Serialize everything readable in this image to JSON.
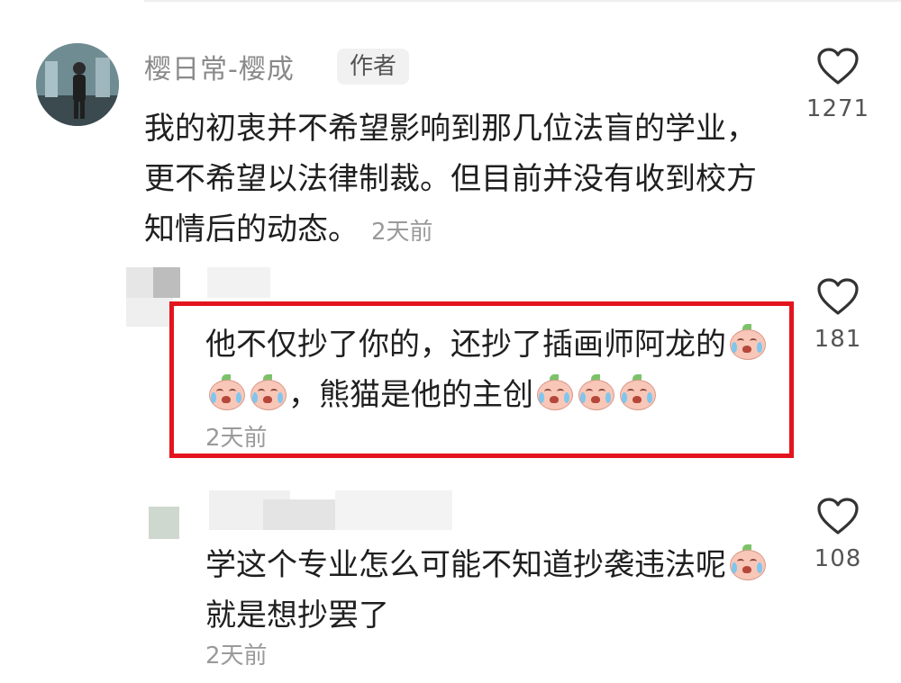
{
  "comments": [
    {
      "author": "樱日常-樱成",
      "badge": "作者",
      "text": "我的初衷并不希望影响到那几位法盲的学业，更不希望以法律制裁。但目前并没有收到校方知情后的动态。",
      "time": "2天前",
      "likes": "1271"
    },
    {
      "text_part1": "他不仅抄了你的，还抄了插画师阿龙的",
      "text_part2": "，熊猫是他的主创",
      "time": "2天前",
      "likes": "181"
    },
    {
      "text_part1": "学这个专业怎么可能不知道抄袭违法呢",
      "text_part2": "就是想抄罢了",
      "time": "2天前",
      "likes": "108"
    }
  ],
  "icons": {
    "like": "heart-outline-icon",
    "emoji": "crying-peach-emoji"
  },
  "colors": {
    "highlight": "#e3141d",
    "muted_text": "#8a8a8a"
  }
}
